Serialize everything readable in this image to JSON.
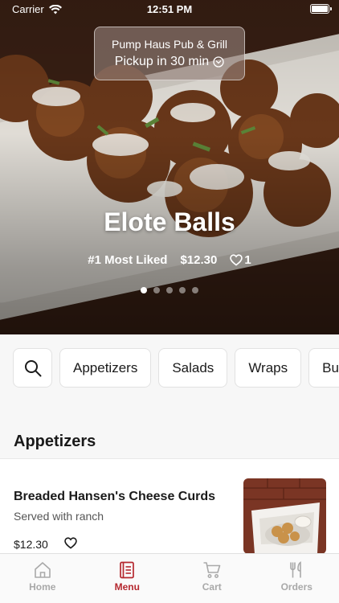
{
  "status_bar": {
    "carrier": "Carrier",
    "time": "12:51 PM"
  },
  "store": {
    "name": "Pump Haus Pub & Grill",
    "pickup": "Pickup in 30 min"
  },
  "hero": {
    "title": "Elote Balls",
    "badge": "#1 Most Liked",
    "price": "$12.30",
    "likes": "1",
    "carousel_pages": 5,
    "active_page": 1
  },
  "categories": [
    {
      "label": "Appetizers"
    },
    {
      "label": "Salads"
    },
    {
      "label": "Wraps"
    },
    {
      "label": "Bu"
    }
  ],
  "section": {
    "title": "Appetizers"
  },
  "menu_items": [
    {
      "name": "Breaded Hansen's Cheese Curds",
      "description": "Served with ranch",
      "price": "$12.30"
    }
  ],
  "tabbar": {
    "items": [
      {
        "label": "Home",
        "icon": "home-icon"
      },
      {
        "label": "Menu",
        "icon": "menu-book-icon"
      },
      {
        "label": "Cart",
        "icon": "cart-icon"
      },
      {
        "label": "Orders",
        "icon": "utensils-icon"
      }
    ],
    "active": "Menu",
    "active_color": "#b5282f",
    "inactive_color": "#a9a9a9"
  }
}
